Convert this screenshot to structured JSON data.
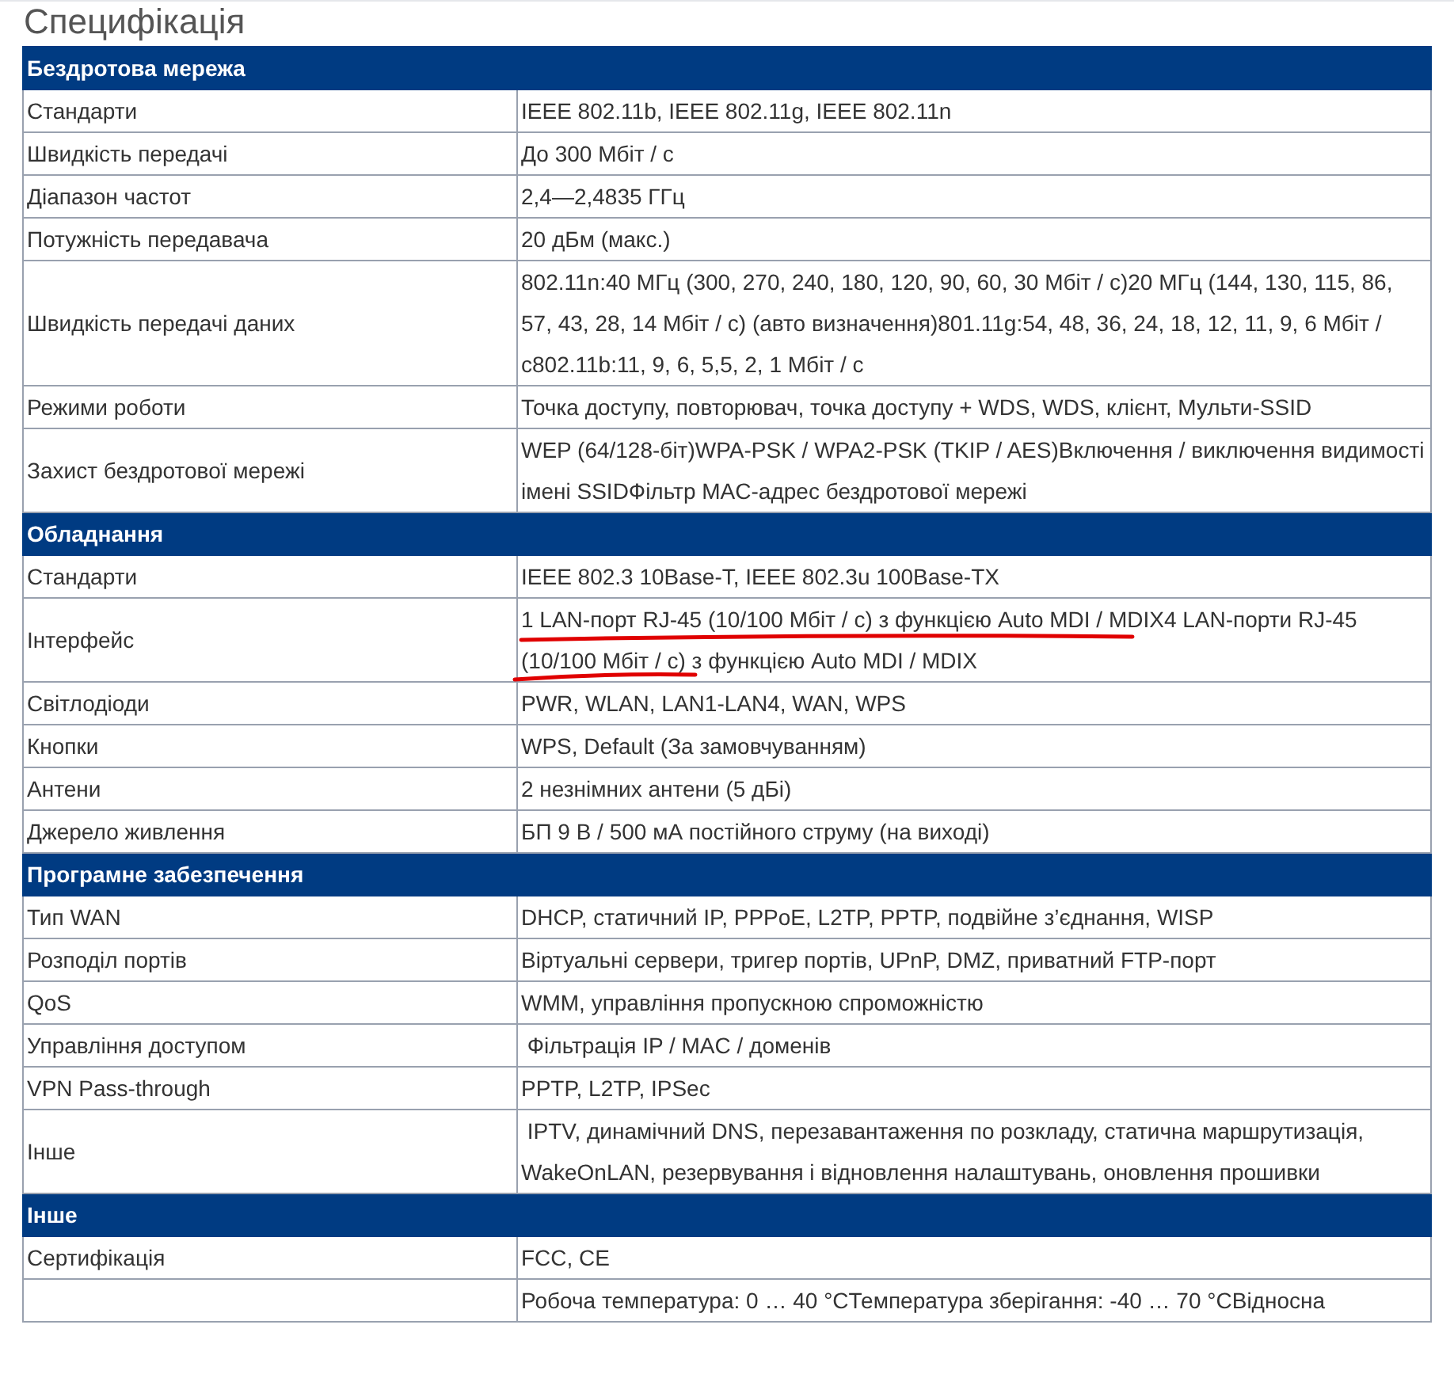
{
  "title": "Специфікація",
  "sections": [
    {
      "heading": "Бездротова мережа",
      "rows": [
        {
          "label": "Стандарти",
          "value": "IEEE 802.11b, IEEE 802.11g, IEEE 802.11n",
          "underlined": false
        },
        {
          "label": "Швидкість передачі",
          "value": "До 300 Мбіт / с",
          "underlined": false
        },
        {
          "label": "Діапазон частот",
          "value": "2,4—2,4835 ГГц",
          "underlined": false
        },
        {
          "label": "Потужність передавача",
          "value": "20 дБм (макс.)",
          "underlined": false
        },
        {
          "label": "Швидкість передачі даних",
          "value": "802.11n:40 МГц (300, 270, 240, 180, 120, 90, 60, 30 Мбіт / с)20 МГц (144, 130, 115, 86, 57, 43, 28, 14 Мбіт / с) (авто визначення)801.11g:54, 48, 36, 24, 18, 12, 11, 9, 6 Мбіт / с802.11b:11, 9, 6, 5,5, 2, 1 Мбіт / с",
          "underlined": false
        },
        {
          "label": "Режими роботи",
          "value": "Точка доступу, повторювач, точка доступу + WDS, WDS, клієнт, Мульти-SSID",
          "underlined": false
        },
        {
          "label": "Захист бездротової мережі",
          "value": "WEP (64/128-біт)WPA-PSK / WPA2-PSK (TKIP / AES)Включення / виключення видимості імені SSIDФільтр MAC-адрес бездротової мережі",
          "underlined": false
        }
      ]
    },
    {
      "heading": "Обладнання",
      "rows": [
        {
          "label": "Стандарти",
          "value": "IEEE 802.3 10Base-T, IEEE 802.3u 100Base-TX",
          "underlined": false
        },
        {
          "label": "Інтерфейс",
          "value": "1 LAN-порт RJ-45 (10/100 Мбіт / с) з функцією Auto MDI / MDIX4 LAN-порти RJ-45 (10/100 Мбіт / с) з функцією Auto MDI / MDIX",
          "underlined": true
        },
        {
          "label": "Світлодіоди",
          "value": "PWR, WLAN, LAN1-LAN4, WAN, WPS",
          "underlined": false
        },
        {
          "label": "Кнопки",
          "value": "WPS, Default (За замовчуванням)",
          "underlined": false
        },
        {
          "label": "Антени",
          "value": "2 незнімних антени (5 дБі)",
          "underlined": false
        },
        {
          "label": "Джерело живлення",
          "value": "БП 9 В / 500 мА постійного струму (на виході)",
          "underlined": false
        }
      ]
    },
    {
      "heading": "Програмне забезпечення",
      "rows": [
        {
          "label": "Тип WAN",
          "value": "DHCP, статичний IP, PPPoE, L2TP, PPTP, подвійне з’єднання, WISP",
          "underlined": false
        },
        {
          "label": "Розподіл портів",
          "value": "Віртуальні сервери, тригер портів, UPnP, DMZ, приватний FTP-порт",
          "underlined": false
        },
        {
          "label": "QoS",
          "value": "WMM, управління пропускною спроможністю",
          "underlined": false
        },
        {
          "label": "Управління доступом",
          "value": " Фільтрація IP / MAC / доменів",
          "underlined": false
        },
        {
          "label": "VPN Pass-through",
          "value": "PPTP, L2TP, IPSec",
          "underlined": false
        },
        {
          "label": "Інше",
          "value": " IPTV, динамічний DNS, перезавантаження по розкладу, статична маршрутизація, WakeOnLAN, резервування і відновлення налаштувань, оновлення прошивки",
          "underlined": false
        }
      ]
    },
    {
      "heading": "Інше",
      "rows": [
        {
          "label": "Сертифікація",
          "value": "FCC, CE",
          "underlined": false
        },
        {
          "value": "Робоча температура: 0 … 40 °CТемпература зберігання: -40 … 70 °CВідносна",
          "underlined": false
        }
      ]
    }
  ]
}
